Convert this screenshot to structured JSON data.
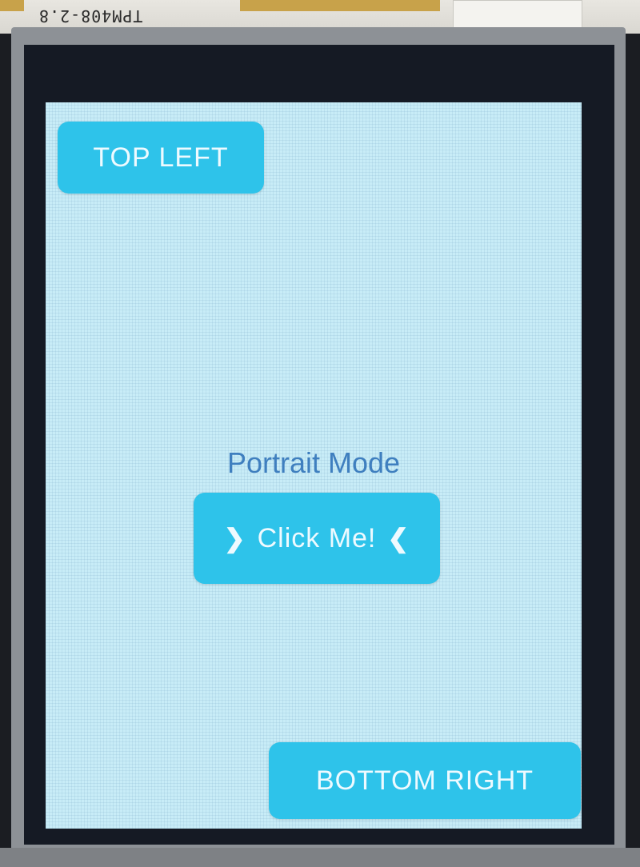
{
  "board": {
    "label": "TPM408-2.8"
  },
  "screen": {
    "title": "Portrait Mode",
    "buttons": {
      "top_left": "TOP LEFT",
      "center": "Click Me!",
      "bottom_right": "BOTTOM RIGHT"
    },
    "center_icons": {
      "left": "chevron-right-icon",
      "right": "chevron-left-icon"
    },
    "colors": {
      "background": "#c8ecf7",
      "button": "#2ec3ea",
      "button_text": "#eefaff",
      "title": "#3f7fbf"
    }
  }
}
